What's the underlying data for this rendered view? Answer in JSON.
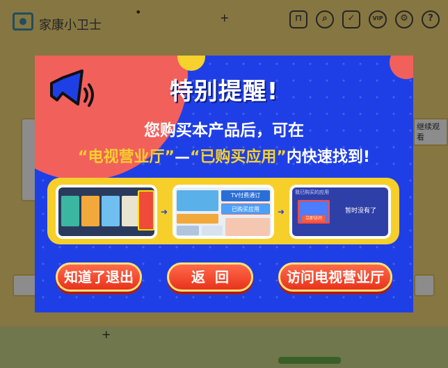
{
  "app": {
    "title": "家康小卫士",
    "side_text": "继续观看",
    "toolbar": [
      {
        "name": "lock-icon",
        "glyph": "🔒"
      },
      {
        "name": "search-icon",
        "glyph": "⌕"
      },
      {
        "name": "calendar-check-icon",
        "glyph": "✓"
      },
      {
        "name": "vip-icon",
        "glyph": "VIP"
      },
      {
        "name": "gear-icon",
        "glyph": "⚙"
      },
      {
        "name": "help-icon",
        "glyph": "?"
      }
    ]
  },
  "modal": {
    "title": "特别提醒!",
    "line1": "您购买本产品后，可在",
    "line2_hl1": "“电视营业厅”",
    "line2_dash": "—",
    "line2_hl2": "“已购买应用”",
    "line2_tail": "内快速找到!",
    "screenshots": {
      "s2_label_a": "TV付费通订",
      "s2_label_b": "已购买应用",
      "s3_header": "我已购买的应用",
      "s3_empty": "暂时没有了",
      "s3_btn": "立即访问"
    },
    "buttons": {
      "exit": "知道了退出",
      "back": "返回",
      "visit": "访问电视营业厅"
    }
  },
  "colors": {
    "modal_bg": "#1f3fe6",
    "accent_yellow": "#f7d12c",
    "accent_red": "#f2605c",
    "button_red": "#e8331c"
  }
}
